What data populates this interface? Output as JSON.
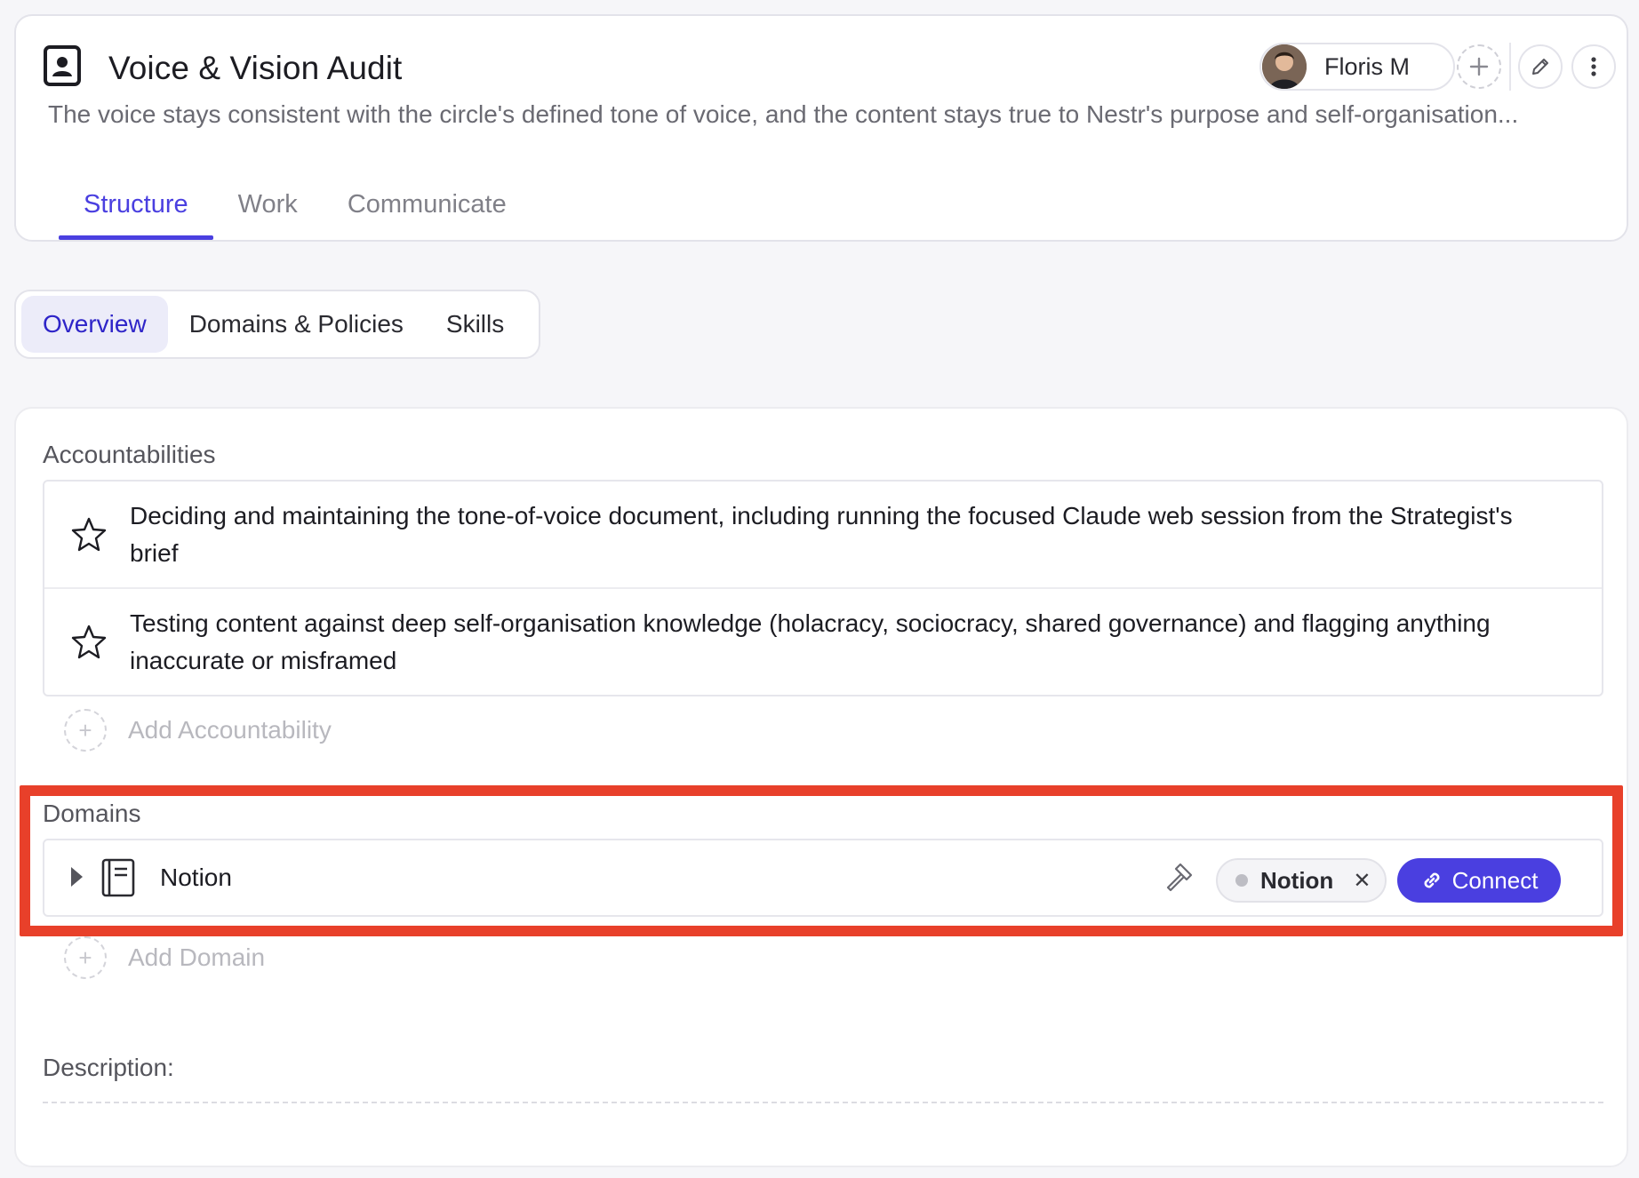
{
  "header": {
    "title": "Voice & Vision Audit",
    "purpose": "The voice stays consistent with the circle's defined tone of voice, and the content stays true to Nestr's purpose and self-organisation...",
    "user_name": "Floris M",
    "tabs": [
      {
        "label": "Structure",
        "active": true
      },
      {
        "label": "Work",
        "active": false
      },
      {
        "label": "Communicate",
        "active": false
      }
    ]
  },
  "subtabs": [
    {
      "label": "Overview",
      "active": true
    },
    {
      "label": "Domains & Policies",
      "active": false
    },
    {
      "label": "Skills",
      "active": false
    }
  ],
  "accountabilities": {
    "label": "Accountabilities",
    "items": [
      {
        "text": "Deciding and maintaining the tone-of-voice document, including running the focused Claude web session from the Strategist's brief"
      },
      {
        "text": "Testing content against deep self-organisation knowledge (holacracy, sociocracy, shared governance) and flagging anything inaccurate or misframed"
      }
    ],
    "add_label": "Add Accountability"
  },
  "domains": {
    "label": "Domains",
    "items": [
      {
        "name": "Notion",
        "tool": "Notion",
        "connect_label": "Connect"
      }
    ],
    "add_label": "Add Domain"
  },
  "description": {
    "label": "Description:"
  },
  "colors": {
    "accent": "#4a3fe0",
    "highlight": "#e8402a"
  }
}
